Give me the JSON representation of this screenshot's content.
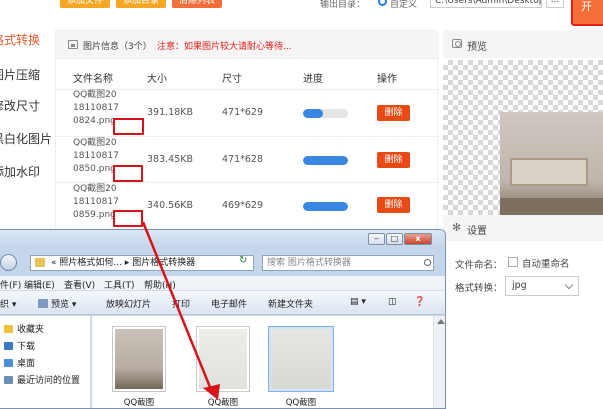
{
  "toolbar": {
    "add_file_label": "添加文件",
    "add_folder_label": "添加目录",
    "clear_list_label": "清除列表",
    "output_dir_label": "输出目录：",
    "output_option_label": "自定义",
    "output_path": "C:\\Users\\Admin\\Desktop\\",
    "browse_label": "...",
    "start_button_label": "开"
  },
  "sidebar": {
    "items": [
      {
        "label": "格式转换",
        "active": true
      },
      {
        "label": "图片压缩",
        "active": false
      },
      {
        "label": "修改尺寸",
        "active": false
      },
      {
        "label": "黑白化图片",
        "active": false
      },
      {
        "label": "添加水印",
        "active": false
      }
    ]
  },
  "file_info": {
    "title": "图片信息（3个）",
    "notice": "注意：如果图片较大请耐心等待...",
    "columns": [
      "文件名称",
      "大小",
      "尺寸",
      "进度",
      "操作"
    ],
    "rows": [
      {
        "name_lines": [
          "QQ截图20",
          "18110817",
          "0824.png"
        ],
        "size": "391.18KB",
        "dimensions": "471*629",
        "progress": 0.45,
        "delete_label": "删除"
      },
      {
        "name_lines": [
          "QQ截图20",
          "18110817",
          "0850.png"
        ],
        "size": "383.45KB",
        "dimensions": "471*628",
        "progress": 1.0,
        "delete_label": "删除"
      },
      {
        "name_lines": [
          "QQ截图20",
          "18110817",
          "0859.png"
        ],
        "size": "340.56KB",
        "dimensions": "469*629",
        "progress": 1.0,
        "delete_label": "删除"
      }
    ]
  },
  "preview": {
    "title": "预览"
  },
  "settings": {
    "title": "设置",
    "filename_label": "文件命名：",
    "auto_rename_label": "自动重命名",
    "format_label": "格式转换：",
    "format_value": "jpg"
  },
  "explorer": {
    "title_buttons": [
      "‒",
      "□",
      "x"
    ],
    "address": "« 照片格式如何... ▸ 图片格式转换器",
    "search_placeholder": "搜索 图片格式转换器",
    "menu": [
      "件(F)",
      "编辑(E)",
      "查看(V)",
      "工具(T)",
      "帮助(H)"
    ],
    "tools": [
      "织 ▾",
      "预览 ▾",
      "放映幻灯片",
      "打印",
      "电子邮件",
      "新建文件夹"
    ],
    "nav": [
      {
        "label": "收藏夹",
        "icon": "star-icon"
      },
      {
        "label": "下载",
        "icon": "download-folder-icon"
      },
      {
        "label": "桌面",
        "icon": "desktop-icon"
      },
      {
        "label": "最近访问的位置",
        "icon": "recent-places-icon"
      }
    ],
    "files": [
      {
        "caption": "QQ截图"
      },
      {
        "caption": "QQ截图"
      },
      {
        "caption": "QQ截图"
      }
    ]
  },
  "colors": {
    "accent_orange": "#f36e39",
    "delete_red": "#e84a16",
    "highlight_red": "#d8141a",
    "progress_blue": "#3a86e3"
  }
}
